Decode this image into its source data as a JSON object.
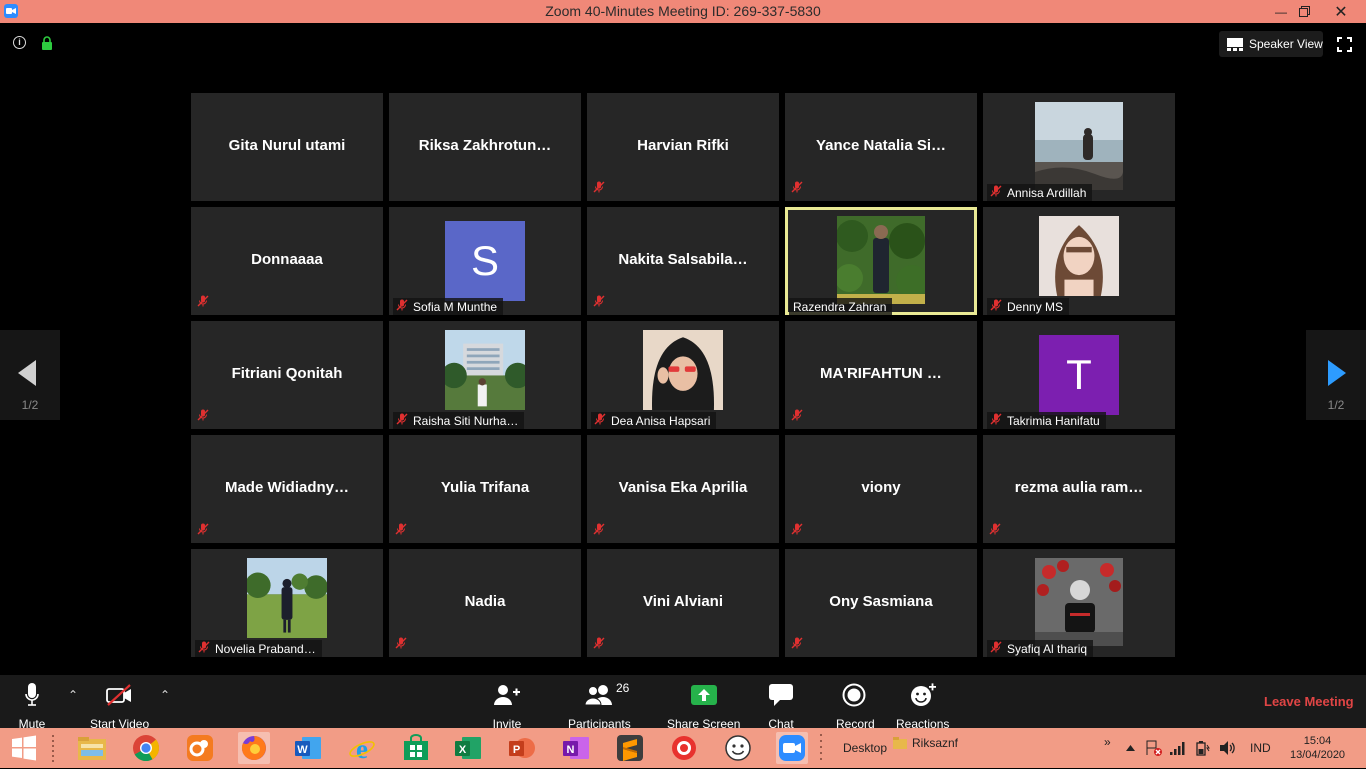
{
  "window": {
    "title": "Zoom 40-Minutes Meeting ID: 269-337-5830"
  },
  "top": {
    "speaker_view": "Speaker View"
  },
  "pager": {
    "prev": "1/2",
    "next": "1/2"
  },
  "colors": {
    "accent": "#2d8cff",
    "active_border": "#e9e994",
    "leave": "#e04545",
    "titlebar": "#f08878",
    "taskbar": "#f29c86"
  },
  "participants": [
    {
      "name": "Gita Nurul utami",
      "muted": false
    },
    {
      "name": "Riksa  Zakhrotun…",
      "muted": false
    },
    {
      "name": "Harvian Rifki",
      "muted": true
    },
    {
      "name": "Yance  Natalia  Si…",
      "muted": true
    },
    {
      "name": "Annisa Ardillah",
      "muted": true,
      "video": "beach"
    },
    {
      "name": "Donnaaaa",
      "muted": true
    },
    {
      "name": "Sofia M Munthe",
      "muted": true,
      "avatar_letter": "S",
      "avatar_color": "#5a67c8"
    },
    {
      "name": "Nakita  Salsabila…",
      "muted": true
    },
    {
      "name": "Razendra Zahran",
      "muted": false,
      "video": "garden",
      "active": true
    },
    {
      "name": "Denny MS",
      "muted": true,
      "video": "portrait"
    },
    {
      "name": "Fitriani Qonitah",
      "muted": true
    },
    {
      "name": "Raisha Siti Nurha…",
      "muted": true,
      "video": "building"
    },
    {
      "name": "Dea Anisa Hapsari",
      "muted": true,
      "video": "hijab"
    },
    {
      "name": "MA'RIFAHTUN …",
      "muted": true
    },
    {
      "name": "Takrimia Hanifatu",
      "muted": true,
      "avatar_letter": "T",
      "avatar_color": "#7c1fb0"
    },
    {
      "name": "Made  Widiadny…",
      "muted": true
    },
    {
      "name": "Yulia Trifana",
      "muted": true
    },
    {
      "name": "Vanisa Eka Aprilia",
      "muted": true
    },
    {
      "name": "viony",
      "muted": true
    },
    {
      "name": "rezma  aulia  ram…",
      "muted": true
    },
    {
      "name": "Novelia Praband…",
      "muted": true,
      "video": "park"
    },
    {
      "name": "Nadia",
      "muted": true
    },
    {
      "name": "Vini Alviani",
      "muted": true
    },
    {
      "name": "Ony Sasmiana",
      "muted": true
    },
    {
      "name": "Syafiq Al thariq",
      "muted": true,
      "video": "flowers"
    }
  ],
  "toolbar": {
    "mute": "Mute",
    "start_video": "Start Video",
    "invite": "Invite",
    "participants": "Participants",
    "participants_count": "26",
    "share_screen": "Share Screen",
    "chat": "Chat",
    "record": "Record",
    "reactions": "Reactions",
    "leave": "Leave Meeting"
  },
  "taskbar": {
    "apps": [
      "start",
      "task-view",
      "file-explorer",
      "chrome",
      "uc-browser",
      "firefox",
      "word",
      "internet-explorer",
      "store",
      "excel",
      "powerpoint",
      "onenote",
      "sublime",
      "recorder",
      "face-app",
      "zoom"
    ],
    "desktop": "Desktop",
    "folder": "Riksaznf",
    "lang": "IND",
    "time": "15:04",
    "date": "13/04/2020"
  }
}
